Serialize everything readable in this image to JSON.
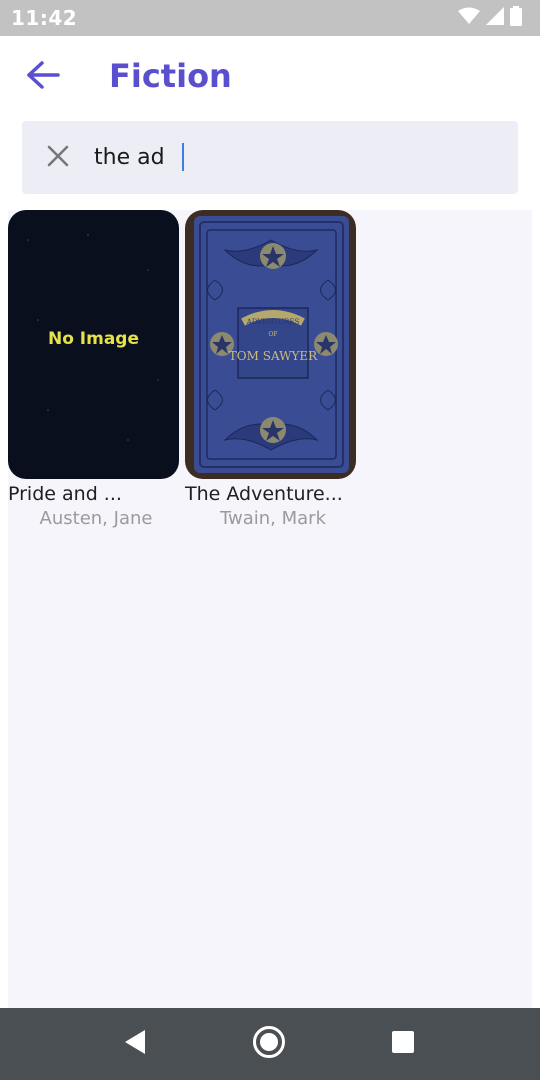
{
  "status_bar": {
    "time": "11:42",
    "icons": [
      "wifi-icon",
      "signal-icon",
      "battery-icon"
    ]
  },
  "app_bar": {
    "title": "Fiction",
    "back_icon": "arrow-back-icon",
    "accent_color": "#5a4fcf"
  },
  "search": {
    "value": "the ad",
    "clear_icon": "close-icon"
  },
  "books": [
    {
      "title": "Pride and ...",
      "author": "Austen, Jane",
      "cover_text": "No Image"
    },
    {
      "title": "The Adventure...",
      "author": "Twain, Mark",
      "cover_text": "ADVENTURES OF TOM SAWYER"
    }
  ],
  "nav_bar": {
    "icons": [
      "nav-back-icon",
      "nav-home-icon",
      "nav-recents-icon"
    ]
  }
}
